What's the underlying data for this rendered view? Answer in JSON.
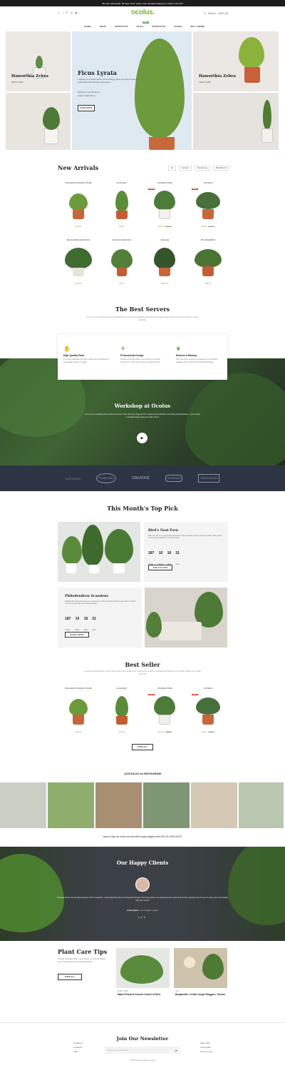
{
  "topbar": {
    "text": "We ship nationwide: 90 days return policy. Free standard shipping on orders over $75"
  },
  "header": {
    "logo": "ocolus.",
    "social_icons": [
      "twitter-icon",
      "facebook-icon",
      "pinterest-icon",
      "instagram-icon",
      "youtube-icon"
    ],
    "search_label": "Search",
    "cart_label": "CART (0)",
    "nav": [
      "HOME",
      "SHOP",
      "PRODUCTS",
      "BLOG",
      "PORTFOLIO",
      "PAGES",
      "BUY THEME"
    ],
    "nav_badge": "HOT"
  },
  "hero": {
    "left_top": {
      "title": "Haworthia Zebra",
      "link": "SHOP NOW"
    },
    "center": {
      "title": "Ficus Lyrata",
      "desc": "Originally from western Africa, these tall leggy plants are quick to make a tropical look with their large waxy leaves.",
      "bullets": [
        "Diameter of pot size 30 cm",
        "Height of plant 65 cm"
      ],
      "button": "SHOP NOW"
    },
    "right_top": {
      "title": "Haworthia Zebra",
      "link": "SHOP NOW"
    }
  },
  "new_arrivals": {
    "title": "New Arrivals",
    "filters": [
      "All",
      "Cactuses",
      "Bonsai Care",
      "Bolt Diamond"
    ],
    "products": [
      {
        "name": "DRACAENA SUNRISE OF FAME",
        "price": "$32.00",
        "old": "",
        "sale": ""
      },
      {
        "name": "ALOE VERA",
        "price": "$4.99",
        "old": "",
        "sale": ""
      },
      {
        "name": "CHAMAECYPARIS",
        "price": "$44.00",
        "old": "$58.00",
        "sale": "SALE"
      },
      {
        "name": "ASCHARIA",
        "price": "$4.99",
        "old": "$19.90",
        "sale": "SALE"
      },
      {
        "name": "BEAUCARNEA RECURVATA",
        "price": "$66.00",
        "old": "",
        "sale": ""
      },
      {
        "name": "ALOCASIA AMAZONICA",
        "price": "$4.99",
        "old": "",
        "sale": ""
      },
      {
        "name": "ARACEAE",
        "price": "$105.00",
        "old": "",
        "sale": ""
      },
      {
        "name": "PHILODENDRON",
        "price": "$99.00",
        "old": "",
        "sale": ""
      }
    ]
  },
  "best_servers": {
    "title": "The Best Servers",
    "desc": "At vero eos et accusamus et iusto odio dignissimos ducimus qui blanditiis praesentium voluptatum deleniti atque corrupti quos dolores et quas molestias.",
    "items": [
      {
        "icon": "hand-plant-icon",
        "title": "High Quality Plant",
        "desc": "It is a long established fact that a reader will be distracted by the readable content of a page."
      },
      {
        "icon": "potted-plant-icon",
        "title": "Professional Design",
        "desc": "Contrary to popular belief, Lorem Ipsum is not simply random text. It has roots in a piece of classical Latin."
      },
      {
        "icon": "watering-hand-icon",
        "title": "Returns & Backup",
        "desc": "There are many variations of passages of Lorem Ipsum available, but the majority have suffered alteration."
      }
    ]
  },
  "workshop": {
    "title": "Workshop at Ocolus",
    "desc": "Join us for a workshop this month as we are in New York City along with our creative demonstration and potting demonstration — and choose a complimentary plant pot to take home!",
    "play_icon": "play-icon"
  },
  "brands": [
    "BOTANIQ",
    "ESTABLISHED",
    "CREATIVE",
    "SUNSHINE",
    "GREEN HOUSE"
  ],
  "top_pick": {
    "title": "This Month's Top Pick",
    "item1": {
      "title": "Bird's Nest Fern",
      "desc": "Bird's Nest Fern is a great low-maintenance little houseplant that is tolerant of shade. Wavy leaves are the perfect addition to a shelf or desk.",
      "countdown": [
        {
          "v": "187",
          "l": "Days"
        },
        {
          "v": "10",
          "l": "Hours"
        },
        {
          "v": "16",
          "l": "Mins"
        },
        {
          "v": "31",
          "l": "Secs"
        }
      ],
      "button": "ADD TO CART"
    },
    "item2": {
      "title": "Philodendron Scandens",
      "desc": "Philodendron Scandens has seen a main stay in the houseplant world for generations. Thanks mostly to its dramatic heart-shaped foliage.",
      "countdown": [
        {
          "v": "187",
          "l": "Days"
        },
        {
          "v": "10",
          "l": "Hours"
        },
        {
          "v": "16",
          "l": "Mins"
        },
        {
          "v": "31",
          "l": "Secs"
        }
      ],
      "button": "QUICK SHOP"
    }
  },
  "best_seller": {
    "title": "Best Seller",
    "desc": "Contrary to popular belief, Lorem Ipsum is not simply random text. It has roots in a piece of classical Latin literature from 45 BC, making it over 2000 years old.",
    "products": [
      {
        "name": "DRACAENA SUNRISE OF FAME",
        "price": "$32.00",
        "old": "",
        "sale": ""
      },
      {
        "name": "ALOE VERA",
        "price": "$4.99",
        "old": "",
        "sale": ""
      },
      {
        "name": "CHAMAECYPARIS",
        "price": "$44.00",
        "old": "$58.00",
        "sale": "SALE"
      },
      {
        "name": "ASCHARIA",
        "price": "$4.99",
        "old": "$19.90",
        "sale": "SALE"
      }
    ],
    "button": "VIEW ALL"
  },
  "instagram": {
    "title": "@OCOLUS on INSTAGRAM",
    "caption": "twice a day we share our favorite images tagged with #OCOLUSPLANTS"
  },
  "clients": {
    "title": "Our Happy Clients",
    "quote": "Amazing theme and top class support. As for a beginner, I was helped the above and beyond and was more than patient. His responses were quick and he has a genuine care for you to enjoy and more forward with your theme!",
    "name": "Annie Quinn",
    "role": "- Co-Founder / Apollo"
  },
  "care_tips": {
    "title": "Plant Care Tips",
    "desc": "Contrary to popular belief, Lorem Ipsum is not simply random text. It has roots in a piece of classical Latin.",
    "button": "VIEW ALL",
    "posts": [
      {
        "cat": "PLANT SHOP",
        "title": "Mama Petula at Ground Control in Paris"
      },
      {
        "cat": "LIFE",
        "title": "Bergamotte x Urban Jungle Bloggers: Yunnan"
      }
    ]
  },
  "footer": {
    "newsletter_title": "Join Our Newsletter",
    "email_placeholder": "Enter your email address",
    "send_icon": "send-icon",
    "left_links": [
      "Contact us",
      "Locations",
      "Jobs"
    ],
    "right_links": [
      "Help / FAQ",
      "Track Order",
      "Terms of Use"
    ],
    "copyright": "© 2020 Ocolus. All rights reserved."
  }
}
